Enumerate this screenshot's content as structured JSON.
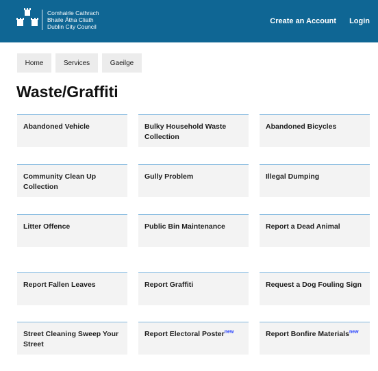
{
  "header": {
    "logo_lines": [
      "Comhairle Cathrach",
      "Bhaile Átha Cliath",
      "Dublin City Council"
    ],
    "links": [
      "Create an Account",
      "Login"
    ],
    "background_color": "#0f6694"
  },
  "breadcrumbs": [
    "Home",
    "Services",
    "Gaeilge"
  ],
  "page": {
    "title": "Waste/Graffiti"
  },
  "services": [
    {
      "label": "Abandoned Vehicle",
      "badge": ""
    },
    {
      "label": "Bulky Household Waste Collection",
      "badge": ""
    },
    {
      "label": "Abandoned Bicycles",
      "badge": ""
    },
    {
      "label": "Community Clean Up Collection",
      "badge": ""
    },
    {
      "label": "Gully Problem",
      "badge": ""
    },
    {
      "label": "Illegal Dumping",
      "badge": ""
    },
    {
      "label": "Litter Offence",
      "badge": ""
    },
    {
      "label": "Public Bin Maintenance",
      "badge": ""
    },
    {
      "label": "Report a Dead Animal",
      "badge": ""
    },
    {
      "label": "Report Fallen Leaves",
      "badge": ""
    },
    {
      "label": "Report Graffiti",
      "badge": ""
    },
    {
      "label": "Request a Dog Fouling Sign",
      "badge": ""
    },
    {
      "label": "Street Cleaning Sweep Your Street",
      "badge": ""
    },
    {
      "label": "Report Electoral Poster",
      "badge": "new"
    },
    {
      "label": "Report Bonfire Materials",
      "badge": "new"
    }
  ],
  "colors": {
    "tile_border": "#7fb6dd",
    "new_badge": "#1f3bff"
  }
}
